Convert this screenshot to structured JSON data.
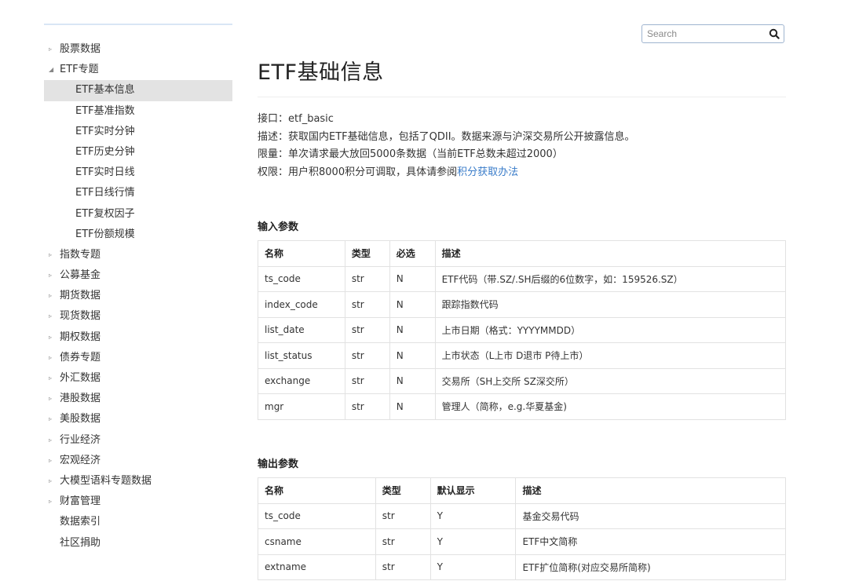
{
  "sidebar": {
    "items": [
      {
        "label": "股票数据",
        "arrow": "▹",
        "level": 0
      },
      {
        "label": "ETF专题",
        "arrow": "◢",
        "level": 0
      },
      {
        "label": "ETF基本信息",
        "arrow": "",
        "level": 1,
        "active": true
      },
      {
        "label": "ETF基准指数",
        "arrow": "",
        "level": 1
      },
      {
        "label": "ETF实时分钟",
        "arrow": "",
        "level": 1
      },
      {
        "label": "ETF历史分钟",
        "arrow": "",
        "level": 1
      },
      {
        "label": "ETF实时日线",
        "arrow": "",
        "level": 1
      },
      {
        "label": "ETF日线行情",
        "arrow": "",
        "level": 1
      },
      {
        "label": "ETF复权因子",
        "arrow": "",
        "level": 1
      },
      {
        "label": "ETF份额规模",
        "arrow": "",
        "level": 1
      },
      {
        "label": "指数专题",
        "arrow": "▹",
        "level": 0
      },
      {
        "label": "公募基金",
        "arrow": "▹",
        "level": 0
      },
      {
        "label": "期货数据",
        "arrow": "▹",
        "level": 0
      },
      {
        "label": "现货数据",
        "arrow": "▹",
        "level": 0
      },
      {
        "label": "期权数据",
        "arrow": "▹",
        "level": 0
      },
      {
        "label": "债券专题",
        "arrow": "▹",
        "level": 0
      },
      {
        "label": "外汇数据",
        "arrow": "▹",
        "level": 0
      },
      {
        "label": "港股数据",
        "arrow": "▹",
        "level": 0
      },
      {
        "label": "美股数据",
        "arrow": "▹",
        "level": 0
      },
      {
        "label": "行业经济",
        "arrow": "▹",
        "level": 0
      },
      {
        "label": "宏观经济",
        "arrow": "▹",
        "level": 0
      },
      {
        "label": "大模型语料专题数据",
        "arrow": "▹",
        "level": 0
      },
      {
        "label": "财富管理",
        "arrow": "▹",
        "level": 0
      },
      {
        "label": "数据索引",
        "arrow": "",
        "level": 0
      },
      {
        "label": "社区捐助",
        "arrow": "",
        "level": 0
      }
    ]
  },
  "search": {
    "placeholder": "Search",
    "value": "",
    "icon": "search-icon"
  },
  "page": {
    "title": "ETF基础信息",
    "interface_label": "接口：",
    "interface_value": "etf_basic",
    "desc_label": "描述：",
    "desc_value": "获取国内ETF基础信息，包括了QDII。数据来源与沪深交易所公开披露信息。",
    "limit_label": "限量：",
    "limit_value": "单次请求最大放回5000条数据（当前ETF总数未超过2000）",
    "perm_label": "权限：",
    "perm_value": "用户积8000积分可调取，具体请参阅",
    "perm_link": "积分获取办法"
  },
  "input_params": {
    "title": "输入参数",
    "headers": [
      "名称",
      "类型",
      "必选",
      "描述"
    ],
    "rows": [
      [
        "ts_code",
        "str",
        "N",
        "ETF代码（带.SZ/.SH后缀的6位数字，如：159526.SZ）"
      ],
      [
        "index_code",
        "str",
        "N",
        "跟踪指数代码"
      ],
      [
        "list_date",
        "str",
        "N",
        "上市日期（格式：YYYYMMDD）"
      ],
      [
        "list_status",
        "str",
        "N",
        "上市状态（L上市 D退市 P待上市）"
      ],
      [
        "exchange",
        "str",
        "N",
        "交易所（SH上交所 SZ深交所）"
      ],
      [
        "mgr",
        "str",
        "N",
        "管理人（简称，e.g.华夏基金)"
      ]
    ]
  },
  "output_params": {
    "title": "输出参数",
    "headers": [
      "名称",
      "类型",
      "默认显示",
      "描述"
    ],
    "rows": [
      [
        "ts_code",
        "str",
        "Y",
        "基金交易代码"
      ],
      [
        "csname",
        "str",
        "Y",
        "ETF中文简称"
      ],
      [
        "extname",
        "str",
        "Y",
        "ETF扩位简称(对应交易所简称)"
      ]
    ]
  }
}
